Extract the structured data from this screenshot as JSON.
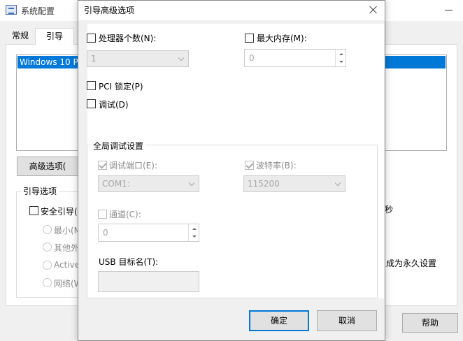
{
  "background_window": {
    "title": "系统配置",
    "tabs": [
      "常规",
      "引导"
    ],
    "os_list_item": "Windows 10 P",
    "advanced_button": "高级选项(",
    "boot_options_group": "引导选项",
    "safe_boot_label": "安全引导(",
    "safe_boot_radios": [
      "最小(M",
      "其他外",
      "Active",
      "网络(W"
    ],
    "seconds_suffix": "秒",
    "permanent_suffix": "置成为永久设置",
    "help_button": "帮助"
  },
  "dialog": {
    "title": "引导高级选项",
    "processors": {
      "label": "处理器个数(N):",
      "checked": false,
      "value": "1"
    },
    "max_memory": {
      "label": "最大内存(M):",
      "checked": false,
      "value": "0"
    },
    "pci_lock": {
      "label": "PCI 锁定(P)",
      "checked": false
    },
    "debug": {
      "label": "调试(D)",
      "checked": false
    },
    "global_debug": {
      "title": "全局调试设置",
      "debug_port": {
        "label": "调试端口(E):",
        "checked": true,
        "value": "COM1:"
      },
      "baud_rate": {
        "label": "波特率(B):",
        "checked": true,
        "value": "115200"
      },
      "channel": {
        "label": "通道(C):",
        "checked": false,
        "value": "0"
      },
      "usb_target": {
        "label": "USB 目标名(T):",
        "value": ""
      }
    },
    "ok_button": "确定",
    "cancel_button": "取消"
  },
  "colors": {
    "selection": "#0078d7",
    "dialog_background": "#f0f0f0",
    "disabled_text": "#8c8c8c"
  }
}
